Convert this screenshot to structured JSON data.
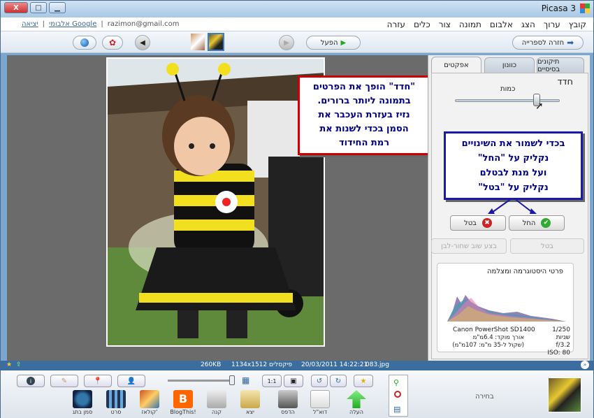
{
  "window": {
    "title": "Picasa 3",
    "controls": {
      "min": "▁",
      "max": "□",
      "close": "X"
    }
  },
  "menu": {
    "items": [
      "קובץ",
      "ערוך",
      "הצג",
      "אלבום",
      "תמונה",
      "צור",
      "כלים",
      "עזרה"
    ]
  },
  "account": {
    "email": "razimon@gmail.com",
    "albums_link": "אלבומי Google",
    "separator": "|",
    "logout": "יציאה"
  },
  "toolbar": {
    "back_to_library": "חזרה לספרייה",
    "play_label": "הפעל"
  },
  "tabs": [
    "תיקונים בסיסיים",
    "כוונון",
    "אפקטים"
  ],
  "panel": {
    "title": "חדד",
    "amount_label": "כמות",
    "amount_value": 0.78,
    "apply_label": "החל",
    "cancel_label": "בטל",
    "apply_disabled": "בטל",
    "apply_bw": "בצע שוב שחור-לבן",
    "histogram_title": "פרטי היסטוגרמה ומצלמה",
    "camera": "Canon PowerShot SD1400",
    "exif_left": [
      "1/250 שניות",
      "f/3.2",
      "ISO: 80"
    ],
    "exif_right": [
      "אורך מוקד: 6.4מ\"מ",
      "(שקול ל-35 מ\"מ: 107מ\"מ)"
    ]
  },
  "callouts": {
    "sharpen": [
      "\"חדד\" הופך את הפרטים",
      "בתמונה ליותר ברורים.",
      "נזיז בעזרת העכבר את",
      "הסמן בכדי לשנות את",
      "רמת החידוד"
    ],
    "save": [
      "בכדי לשמור את השינויים",
      "נקליק על \"החל\"",
      "ועל מנת לבטלם",
      "נקליק על \"בטל\""
    ]
  },
  "status": {
    "filename": "083.jpg",
    "datetime": "20/03/2011 14:22:21",
    "dimensions": "1134x1512 פיקסלים",
    "size": "260KB"
  },
  "bottom": {
    "tray_label": "בחירה",
    "tools": [
      "העלה",
      "דוא\"ל",
      "הדפס",
      "יצא",
      "קנה",
      "BlogThis!",
      "קולאז'",
      "סרט",
      "סמן בתג"
    ]
  },
  "colors": {
    "accent": "#3b6e9e",
    "callout_red": "#cc0000",
    "callout_blue": "#1a1aa8",
    "text_blue": "#00008b"
  }
}
